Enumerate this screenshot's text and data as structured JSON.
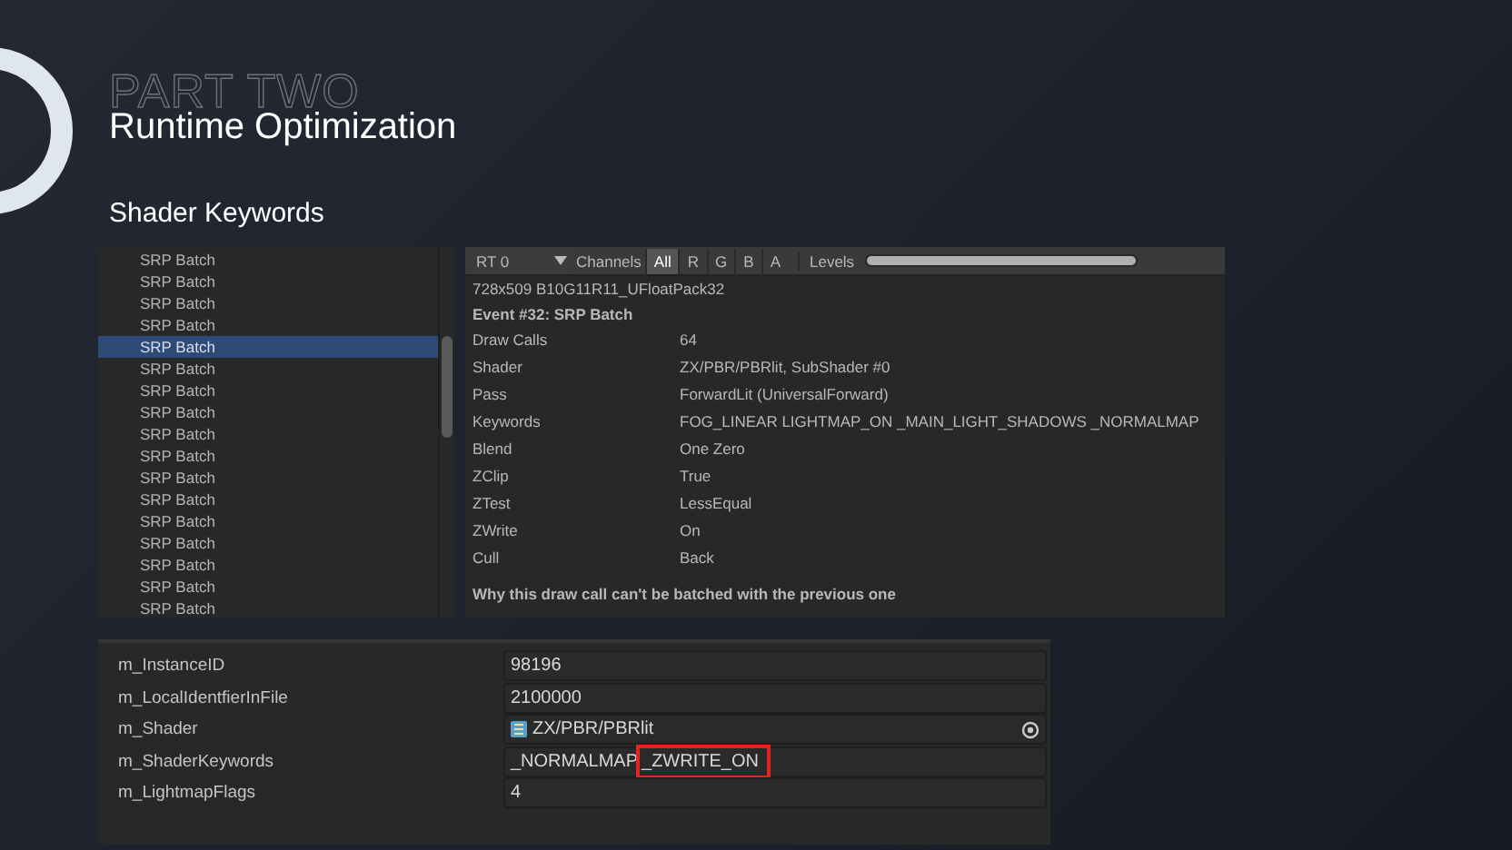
{
  "slide": {
    "kicker": "PART TWO",
    "title": "Runtime Optimization",
    "subtitle": "Shader Keywords"
  },
  "event_list": {
    "items": [
      {
        "label": "SRP Batch",
        "selected": false
      },
      {
        "label": "SRP Batch",
        "selected": false
      },
      {
        "label": "SRP Batch",
        "selected": false
      },
      {
        "label": "SRP Batch",
        "selected": false
      },
      {
        "label": "SRP Batch",
        "selected": true
      },
      {
        "label": "SRP Batch",
        "selected": false
      },
      {
        "label": "SRP Batch",
        "selected": false
      },
      {
        "label": "SRP Batch",
        "selected": false
      },
      {
        "label": "SRP Batch",
        "selected": false
      },
      {
        "label": "SRP Batch",
        "selected": false
      },
      {
        "label": "SRP Batch",
        "selected": false
      },
      {
        "label": "SRP Batch",
        "selected": false
      },
      {
        "label": "SRP Batch",
        "selected": false
      },
      {
        "label": "SRP Batch",
        "selected": false
      },
      {
        "label": "SRP Batch",
        "selected": false
      },
      {
        "label": "SRP Batch",
        "selected": false
      },
      {
        "label": "SRP Batch",
        "selected": false
      }
    ]
  },
  "detail": {
    "toolbar": {
      "target": "RT 0",
      "channels_label": "Channels",
      "channels": [
        {
          "label": "All",
          "selected": true
        },
        {
          "label": "R",
          "selected": false
        },
        {
          "label": "G",
          "selected": false
        },
        {
          "label": "B",
          "selected": false
        },
        {
          "label": "A",
          "selected": false
        }
      ],
      "levels_label": "Levels",
      "level": 1
    },
    "format": "728x509 B10G11R11_UFloatPack32",
    "event_title": "Event #32: SRP Batch",
    "properties": [
      {
        "name": "Draw Calls",
        "value": "64"
      },
      {
        "name": "Shader",
        "value": "ZX/PBR/PBRlit, SubShader #0"
      },
      {
        "name": "Pass",
        "value": "ForwardLit (UniversalForward)"
      },
      {
        "name": "Keywords",
        "value": "FOG_LINEAR LIGHTMAP_ON _MAIN_LIGHT_SHADOWS _NORMALMAP"
      },
      {
        "name": "Blend",
        "value": "One Zero"
      },
      {
        "name": "ZClip",
        "value": "True"
      },
      {
        "name": "ZTest",
        "value": "LessEqual"
      },
      {
        "name": "ZWrite",
        "value": "On"
      },
      {
        "name": "Cull",
        "value": "Back"
      }
    ],
    "batch_note": "Why this draw call can't be batched with the previous one"
  },
  "inspector": {
    "rows": [
      {
        "name": "m_InstanceID",
        "kind": "text",
        "parts": [
          {
            "text": "98196",
            "highlighted": false
          }
        ]
      },
      {
        "name": "m_LocalIdentfierInFile",
        "kind": "text",
        "parts": [
          {
            "text": "2100000",
            "highlighted": false
          }
        ]
      },
      {
        "name": "m_Shader",
        "kind": "object",
        "parts": [
          {
            "text": "ZX/PBR/PBRlit",
            "highlighted": false
          }
        ]
      },
      {
        "name": "m_ShaderKeywords",
        "kind": "text",
        "parts": [
          {
            "text": "_NORMALMAP",
            "highlighted": false
          },
          {
            "text": "_ZWRITE_ON",
            "highlighted": true
          }
        ]
      },
      {
        "name": "m_LightmapFlags",
        "kind": "text",
        "parts": [
          {
            "text": "4",
            "highlighted": false
          }
        ]
      }
    ]
  }
}
